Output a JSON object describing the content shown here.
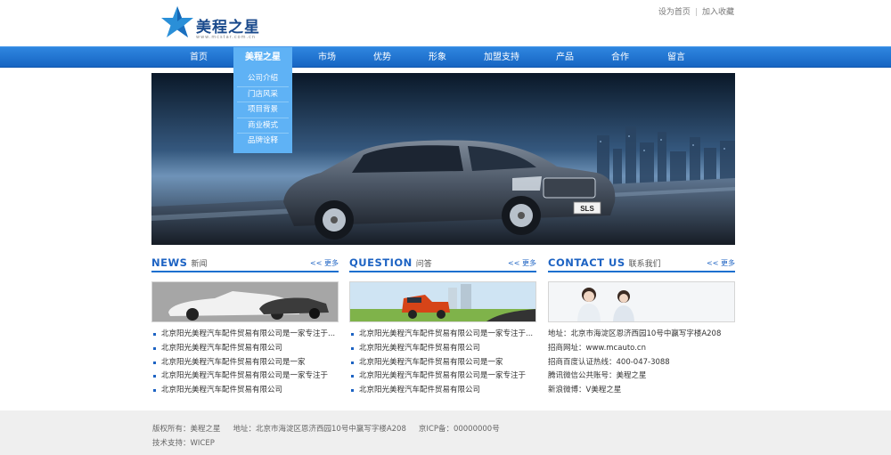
{
  "header": {
    "logo_title": "美程之星",
    "logo_url": "www.mcstar.com.cn",
    "toplinks": [
      "设为首页",
      "加入收藏"
    ]
  },
  "nav": {
    "items": [
      "首页",
      "美程之星",
      "市场",
      "优势",
      "形象",
      "加盟支持",
      "产品",
      "合作",
      "留言"
    ],
    "active": "美程之星",
    "dropdown": [
      "公司介绍",
      "门店风采",
      "项目背景",
      "商业模式",
      "品牌诠释"
    ]
  },
  "banner": {
    "plate": "SLS"
  },
  "news": {
    "title_en": "NEWS",
    "title_cn": "新闻",
    "more": "<< 更多",
    "items": [
      "北京阳光美程汽车配件贸易有限公司是一家专注于...",
      "北京阳光美程汽车配件贸易有限公司",
      "北京阳光美程汽车配件贸易有限公司是一家",
      "北京阳光美程汽车配件贸易有限公司是一家专注于",
      "北京阳光美程汽车配件贸易有限公司"
    ]
  },
  "question": {
    "title_en": "QUESTION",
    "title_cn": "问答",
    "more": "<< 更多",
    "items": [
      "北京阳光美程汽车配件贸易有限公司是一家专注于...",
      "北京阳光美程汽车配件贸易有限公司",
      "北京阳光美程汽车配件贸易有限公司是一家",
      "北京阳光美程汽车配件贸易有限公司是一家专注于",
      "北京阳光美程汽车配件贸易有限公司"
    ]
  },
  "contact": {
    "title_en": "CONTACT US",
    "title_cn": "联系我们",
    "more": "<< 更多",
    "lines": [
      "地址：北京市海淀区恩济西园10号中赢写字楼A208",
      "招商网址：www.mcauto.cn",
      "招商百度认证热线：400-047-3088",
      "腾讯微信公共账号：美程之星",
      "新浪微博：V美程之星"
    ]
  },
  "footer": {
    "copyright": "版权所有：美程之星",
    "address": "地址：北京市海淀区恩济西园10号中赢写字楼A208",
    "icp": "京ICP备：00000000号",
    "support": "技术支持：WICEP"
  },
  "colors": {
    "nav_blue": "#1f74d2",
    "active_blue": "#5fb2f5",
    "title_blue": "#1d63c3",
    "footer_bg": "#efefef"
  }
}
